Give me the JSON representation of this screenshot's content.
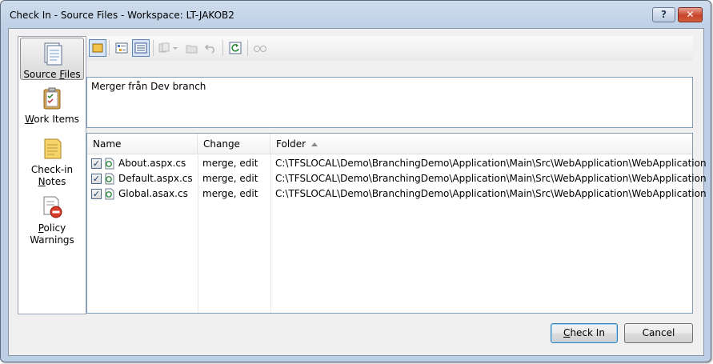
{
  "window": {
    "title": "Check In - Source Files - Workspace: LT-JAKOB2",
    "help_label": "?",
    "close_label": "✕"
  },
  "nav": {
    "items": [
      {
        "pre": "Source ",
        "u": "F",
        "post": "iles",
        "icon": "source-files-icon"
      },
      {
        "pre": "",
        "u": "W",
        "post": "ork Items",
        "icon": "work-items-icon"
      },
      {
        "line1": "Check-in",
        "pre": "",
        "u": "N",
        "post": "otes",
        "icon": "checkin-notes-icon"
      },
      {
        "line1": "",
        "pre": "",
        "u": "P",
        "post": "olicy",
        "line2": "Warnings",
        "icon": "policy-warnings-icon"
      }
    ]
  },
  "comment": {
    "text": "Merger från Dev branch"
  },
  "table": {
    "columns": [
      "Name",
      "Change",
      "Folder"
    ],
    "rows": [
      {
        "name": "About.aspx.cs",
        "change": "merge, edit",
        "folder": "C:\\TFSLOCAL\\Demo\\BranchingDemo\\Application\\Main\\Src\\WebApplication\\WebApplication"
      },
      {
        "name": "Default.aspx.cs",
        "change": "merge, edit",
        "folder": "C:\\TFSLOCAL\\Demo\\BranchingDemo\\Application\\Main\\Src\\WebApplication\\WebApplication"
      },
      {
        "name": "Global.asax.cs",
        "change": "merge, edit",
        "folder": "C:\\TFSLOCAL\\Demo\\BranchingDemo\\Application\\Main\\Src\\WebApplication\\WebApplication"
      }
    ]
  },
  "buttons": {
    "checkin_u": "C",
    "checkin_rest": "heck In",
    "cancel": "Cancel"
  }
}
